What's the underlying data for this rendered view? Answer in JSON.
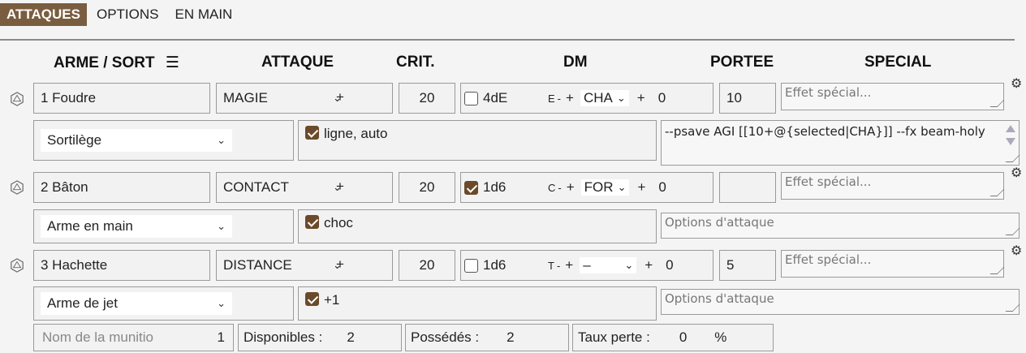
{
  "tabs": [
    {
      "label": "ATTAQUES",
      "active": true
    },
    {
      "label": "OPTIONS",
      "active": false
    },
    {
      "label": "EN MAIN",
      "active": false
    }
  ],
  "headers": {
    "arme_sort": "ARME / SORT",
    "attaque": "ATTAQUE",
    "crit": "CRIT.",
    "dm": "DM",
    "portee": "PORTEE",
    "special": "SPECIAL"
  },
  "special_placeholder": "Effet spécial...",
  "options_placeholder": "Options d'attaque",
  "rows": [
    {
      "name": "1 Foudre",
      "attack": "MAGIE",
      "plus": "+",
      "crit": "20",
      "dm_checked": false,
      "dm": "4dE",
      "dm_code": "E",
      "dash": "-",
      "carac": "CHA",
      "bonus": "0",
      "portee": "10",
      "type": "Sortilège",
      "option_checked": true,
      "option": "ligne, auto",
      "script": "--psave AGI [[10+@{selected|CHA}]] --fx beam-holy"
    },
    {
      "name": "2 Bâton",
      "attack": "CONTACT",
      "plus": "+",
      "crit": "20",
      "dm_checked": true,
      "dm": "1d6",
      "dm_code": "C",
      "dash": "-",
      "carac": "FOR",
      "bonus": "0",
      "portee": "",
      "type": "Arme en main",
      "option_checked": true,
      "option": "choc",
      "script": ""
    },
    {
      "name": "3 Hachette",
      "attack": "DISTANCE",
      "plus": "+",
      "crit": "20",
      "dm_checked": false,
      "dm": "1d6",
      "dm_code": "T",
      "dash": "-",
      "carac": "–",
      "bonus": "0",
      "portee": "5",
      "type": "Arme de jet",
      "option_checked": true,
      "option": "+1",
      "script": ""
    }
  ],
  "ammo": {
    "name_placeholder": "Nom de la munitio",
    "name_value": "1",
    "disponibles_label": "Disponibles :",
    "disponibles_value": "2",
    "possedes_label": "Possédés :",
    "possedes_value": "2",
    "taux_label": "Taux perte :",
    "taux_value": "0",
    "taux_unit": "%"
  }
}
